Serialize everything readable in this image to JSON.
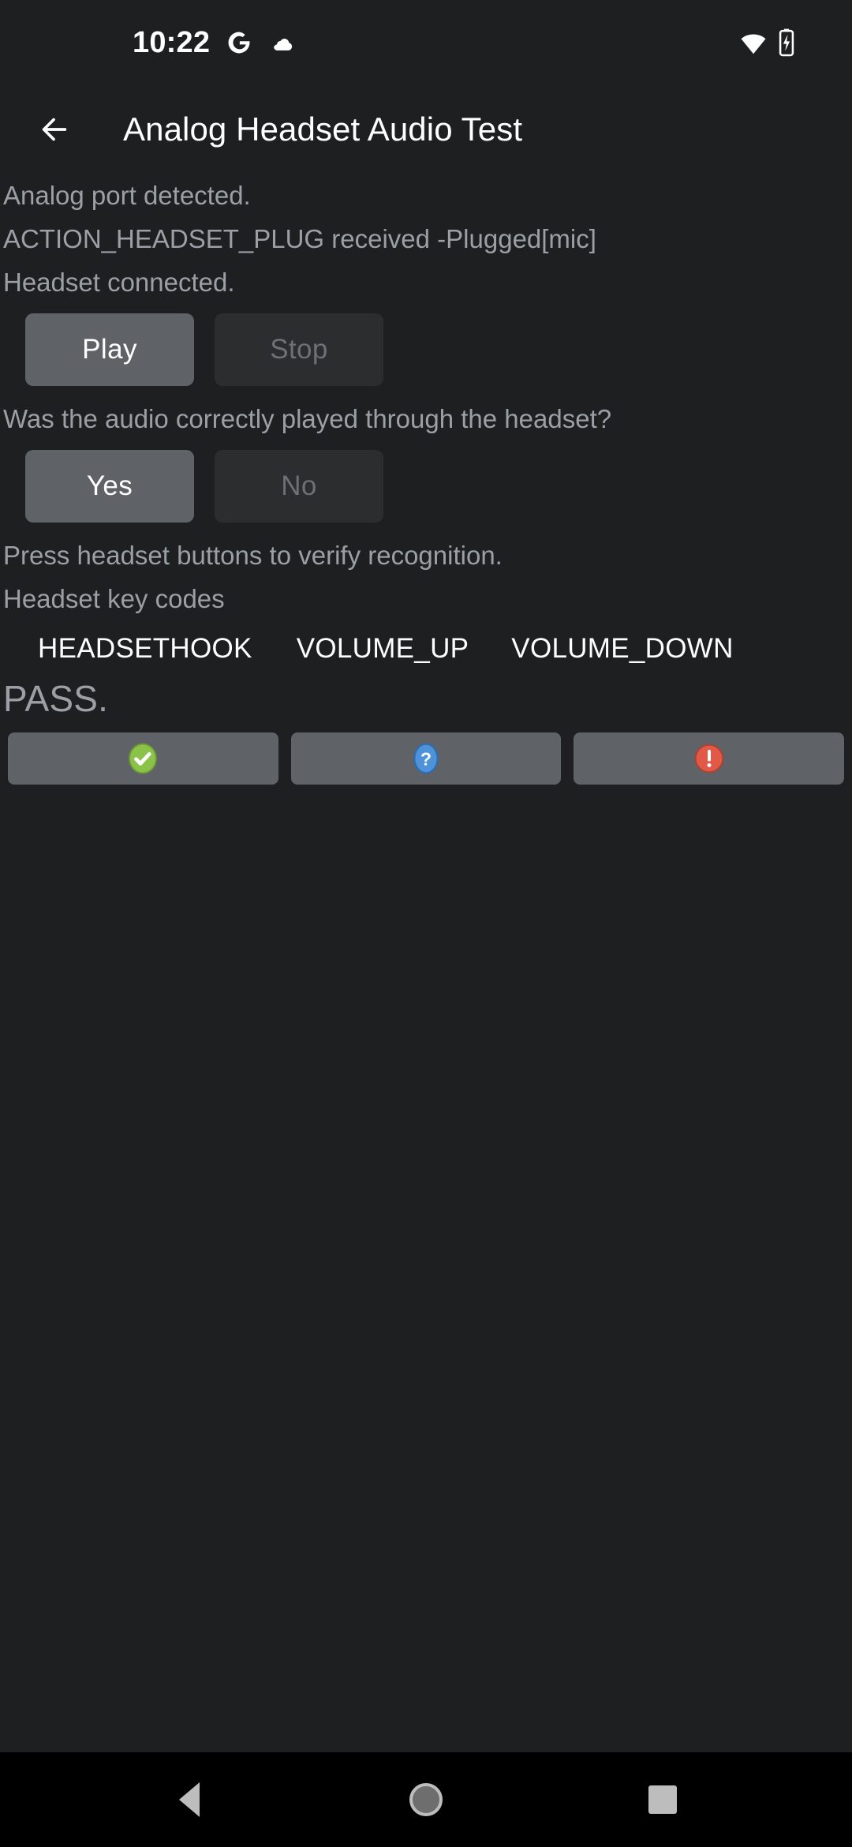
{
  "status_bar": {
    "time": "10:22",
    "icons_left": [
      "google-g-icon",
      "cloud-icon"
    ],
    "icons_right": [
      "wifi-icon",
      "battery-charging-icon"
    ]
  },
  "app_bar": {
    "back_icon": "back-arrow-icon",
    "title": "Analog Headset Audio Test"
  },
  "content": {
    "status_lines": [
      "Analog port detected.",
      "ACTION_HEADSET_PLUG received -Plugged[mic]",
      "Headset connected."
    ],
    "playback_buttons": [
      {
        "label": "Play",
        "enabled": true
      },
      {
        "label": "Stop",
        "enabled": false
      }
    ],
    "question": "Was the audio correctly played through the headset?",
    "answer_buttons": [
      {
        "label": "Yes",
        "enabled": true
      },
      {
        "label": "No",
        "enabled": false
      }
    ],
    "instruction": "Press headset buttons to verify recognition.",
    "keycodes_label": "Headset key codes",
    "keycodes": [
      "HEADSETHOOK",
      "VOLUME_UP",
      "VOLUME_DOWN"
    ],
    "verdict": "PASS."
  },
  "action_bar": {
    "buttons": [
      {
        "icon": "pass-check-icon",
        "color": "#8bc34a"
      },
      {
        "icon": "info-question-icon",
        "color": "#4e93d9"
      },
      {
        "icon": "fail-exclamation-icon",
        "color": "#e05a47"
      }
    ]
  },
  "nav_bar": {
    "items": [
      "nav-back-icon",
      "nav-home-icon",
      "nav-recents-icon"
    ]
  },
  "colors": {
    "background": "#1d1f21",
    "button_enabled": "#5f6368",
    "button_disabled": "#2b2d2f",
    "text_primary": "#ffffff",
    "text_secondary": "#9aa0a6"
  }
}
